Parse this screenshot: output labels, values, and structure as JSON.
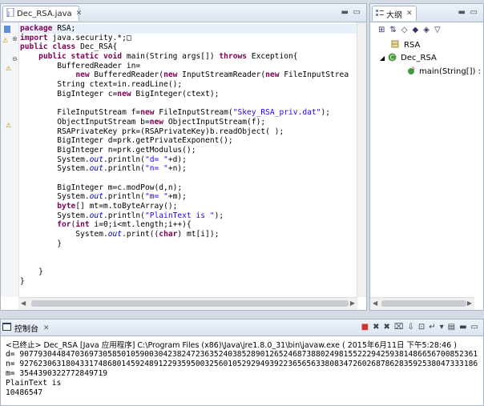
{
  "editor": {
    "tab_label": "Dec_RSA.java",
    "close_glyph": "✕",
    "code_lines": [
      [
        [
          "kw",
          "package"
        ],
        [
          "t",
          " RSA;"
        ]
      ],
      [
        [
          "kw",
          "import"
        ],
        [
          "t",
          " java.security.*;"
        ],
        [
          "t",
          "□"
        ]
      ],
      [
        [
          "kw",
          "public class"
        ],
        [
          "t",
          " Dec_RSA{"
        ]
      ],
      [
        [
          "t",
          "    "
        ],
        [
          "kw",
          "public static void"
        ],
        [
          "t",
          " main(String args[]) "
        ],
        [
          "kw",
          "throws"
        ],
        [
          "t",
          " Exception{"
        ]
      ],
      [
        [
          "t",
          "        BufferedReader in="
        ]
      ],
      [
        [
          "t",
          "            "
        ],
        [
          "kw",
          "new"
        ],
        [
          "t",
          " BufferedReader("
        ],
        [
          "kw",
          "new"
        ],
        [
          "t",
          " InputStreamReader("
        ],
        [
          "kw",
          "new"
        ],
        [
          "t",
          " FileInputStrea"
        ]
      ],
      [
        [
          "t",
          "        String ctext=in.readLine();"
        ]
      ],
      [
        [
          "t",
          "        BigInteger c="
        ],
        [
          "kw",
          "new"
        ],
        [
          "t",
          " BigInteger(ctext);"
        ]
      ],
      [
        [
          "t",
          ""
        ]
      ],
      [
        [
          "t",
          "        FileInputStream f="
        ],
        [
          "kw",
          "new"
        ],
        [
          "t",
          " FileInputStream("
        ],
        [
          "str",
          "\"Skey_RSA_priv.dat\""
        ],
        [
          "t",
          ");"
        ]
      ],
      [
        [
          "t",
          "        ObjectInputStream b="
        ],
        [
          "kw",
          "new"
        ],
        [
          "t",
          " ObjectInputStream(f);"
        ]
      ],
      [
        [
          "t",
          "        RSAPrivateKey prk=(RSAPrivateKey)b.readObject( );"
        ]
      ],
      [
        [
          "t",
          "        BigInteger d=prk.getPrivateExponent();"
        ]
      ],
      [
        [
          "t",
          "        BigInteger n=prk.getModulus();"
        ]
      ],
      [
        [
          "t",
          "        System."
        ],
        [
          "fld",
          "out"
        ],
        [
          "t",
          ".println("
        ],
        [
          "str",
          "\"d= \""
        ],
        [
          "t",
          "+d);"
        ]
      ],
      [
        [
          "t",
          "        System."
        ],
        [
          "fld",
          "out"
        ],
        [
          "t",
          ".println("
        ],
        [
          "str",
          "\"n= \""
        ],
        [
          "t",
          "+n);"
        ]
      ],
      [
        [
          "t",
          ""
        ]
      ],
      [
        [
          "t",
          "        BigInteger m=c.modPow(d,n);"
        ]
      ],
      [
        [
          "t",
          "        System."
        ],
        [
          "fld",
          "out"
        ],
        [
          "t",
          ".println("
        ],
        [
          "str",
          "\"m= \""
        ],
        [
          "t",
          "+m);"
        ]
      ],
      [
        [
          "t",
          "        "
        ],
        [
          "kw",
          "byte"
        ],
        [
          "t",
          "[] mt=m.toByteArray();"
        ]
      ],
      [
        [
          "t",
          "        System."
        ],
        [
          "fld",
          "out"
        ],
        [
          "t",
          ".println("
        ],
        [
          "str",
          "\"PlainText is \""
        ],
        [
          "t",
          ");"
        ]
      ],
      [
        [
          "t",
          "        "
        ],
        [
          "kw",
          "for"
        ],
        [
          "t",
          "("
        ],
        [
          "kw",
          "int"
        ],
        [
          "t",
          " i=0;i<mt.length;i++){"
        ]
      ],
      [
        [
          "t",
          "            System."
        ],
        [
          "fld",
          "out"
        ],
        [
          "t",
          ".print(("
        ],
        [
          "kw",
          "char"
        ],
        [
          "t",
          ") mt[i]);"
        ]
      ],
      [
        [
          "t",
          "        }"
        ]
      ],
      [
        [
          "t",
          ""
        ]
      ],
      [
        [
          "t",
          ""
        ]
      ],
      [
        [
          "t",
          "    }"
        ]
      ],
      [
        [
          "t",
          "}"
        ]
      ]
    ]
  },
  "outline": {
    "tab_label": "大纲",
    "close_glyph": "✕",
    "items": [
      {
        "label": "RSA",
        "icon": "package-icon"
      },
      {
        "label": "Dec_RSA",
        "icon": "class-icon"
      },
      {
        "label": "main(String[]) :",
        "icon": "method-icon"
      }
    ]
  },
  "console": {
    "tab_label": "控制台",
    "close_glyph": "✕",
    "status": "<已终止> Dec_RSA [Java 应用程序] C:\\Program Files (x86)\\Java\\jre1.8.0_31\\bin\\javaw.exe ( 2015年6月11日 下午5:28:46 )",
    "output_lines": [
      "d= 907793044847036973058501059003042382472363524038528901265246873880249815522294259381486656700852361",
      "n= 927623063180433174868014592489122935950032560105292949392236565633808347260268786283592538047333186",
      "m= 3544390322772849719",
      "PlainText is",
      "10486547"
    ]
  },
  "colors": {
    "keyword": "#7f0055",
    "string": "#2a00ff",
    "field": "#0000c0",
    "accent": "#a7b6c9"
  }
}
